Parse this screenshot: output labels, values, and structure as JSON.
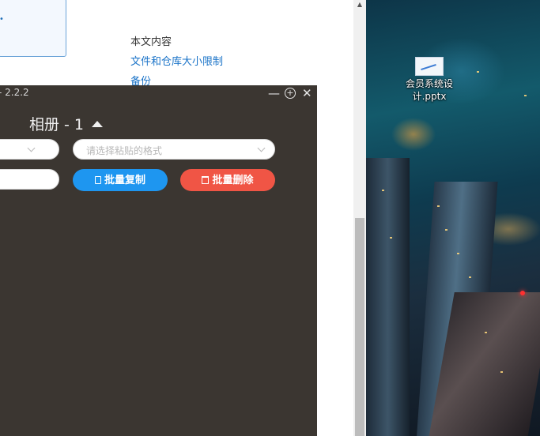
{
  "browser": {
    "toc_title": "本文内容",
    "toc_links": [
      "文件和仓库大小限制",
      "备份"
    ]
  },
  "desktop": {
    "icon_label_line1": "会员系统设",
    "icon_label_line2": "计.pptx"
  },
  "app": {
    "version": "- 2.2.2",
    "controls": {
      "minimize": "—",
      "fullscreen": "+",
      "close": "✕"
    },
    "album_title": "相册 - 1",
    "format_select_placeholder": "请选择粘贴的格式",
    "batch_copy_label": "批量复制",
    "batch_delete_label": "批量删除"
  },
  "icons": [
    "chevron-down-icon",
    "document-icon",
    "trash-icon",
    "triangle-up-icon"
  ],
  "colors": {
    "copy": "#1e96f0",
    "delete": "#f05545",
    "app_bg": "#3b3631",
    "link": "#1a73c8"
  }
}
